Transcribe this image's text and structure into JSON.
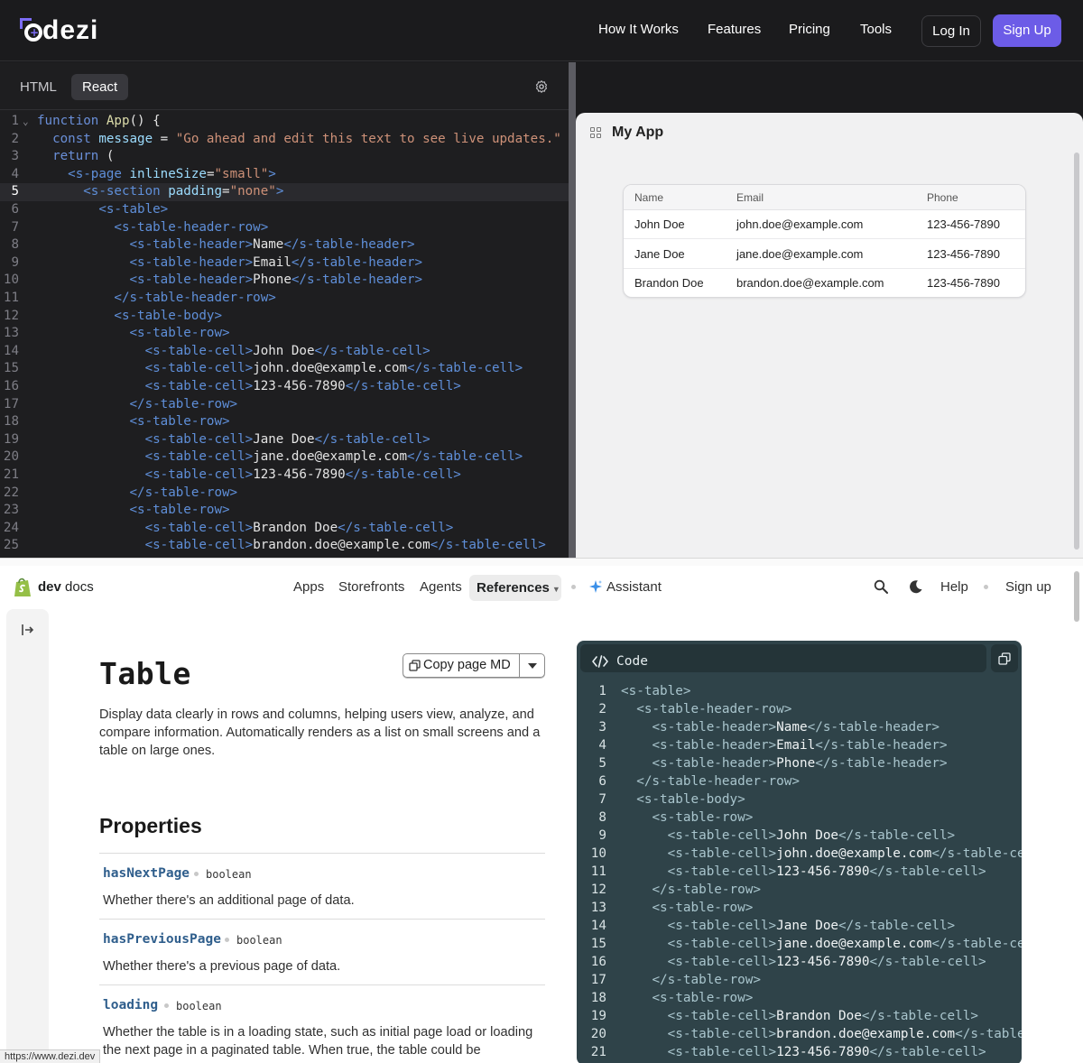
{
  "dezi": {
    "logo_text": "dezi",
    "nav": [
      "How It Works",
      "Features",
      "Pricing",
      "Tools"
    ],
    "login": "Log In",
    "signup": "Sign Up",
    "editor_tabs": [
      "HTML",
      "React"
    ],
    "active_tab": "React",
    "active_line": 5,
    "code": [
      [
        [
          "k",
          "function "
        ],
        [
          "fn",
          "App"
        ],
        [
          "tt",
          "() {"
        ]
      ],
      [
        [
          "tt",
          "  "
        ],
        [
          "k",
          "const "
        ],
        [
          "at",
          "message"
        ],
        [
          "tt",
          " = "
        ],
        [
          "str",
          "\"Go ahead and edit this text to see live updates.\""
        ]
      ],
      [
        [
          "tt",
          "  "
        ],
        [
          "k",
          "return"
        ],
        [
          "tt",
          " ("
        ]
      ],
      [
        [
          "tt",
          "    "
        ],
        [
          "tag",
          "<s-page "
        ],
        [
          "at",
          "inlineSize"
        ],
        [
          "tt",
          "="
        ],
        [
          "str",
          "\"small\""
        ],
        [
          "tag",
          ">"
        ]
      ],
      [
        [
          "tt",
          "      "
        ],
        [
          "tag",
          "<s-section "
        ],
        [
          "at",
          "padding"
        ],
        [
          "tt",
          "="
        ],
        [
          "str",
          "\"none\""
        ],
        [
          "tag",
          ">"
        ]
      ],
      [
        [
          "tt",
          "        "
        ],
        [
          "tag",
          "<s-table>"
        ]
      ],
      [
        [
          "tt",
          "          "
        ],
        [
          "tag",
          "<s-table-header-row>"
        ]
      ],
      [
        [
          "tt",
          "            "
        ],
        [
          "tag",
          "<s-table-header>"
        ],
        [
          "tt",
          "Name"
        ],
        [
          "tag",
          "</s-table-header>"
        ]
      ],
      [
        [
          "tt",
          "            "
        ],
        [
          "tag",
          "<s-table-header>"
        ],
        [
          "tt",
          "Email"
        ],
        [
          "tag",
          "</s-table-header>"
        ]
      ],
      [
        [
          "tt",
          "            "
        ],
        [
          "tag",
          "<s-table-header>"
        ],
        [
          "tt",
          "Phone"
        ],
        [
          "tag",
          "</s-table-header>"
        ]
      ],
      [
        [
          "tt",
          "          "
        ],
        [
          "tag",
          "</s-table-header-row>"
        ]
      ],
      [
        [
          "tt",
          "          "
        ],
        [
          "tag",
          "<s-table-body>"
        ]
      ],
      [
        [
          "tt",
          "            "
        ],
        [
          "tag",
          "<s-table-row>"
        ]
      ],
      [
        [
          "tt",
          "              "
        ],
        [
          "tag",
          "<s-table-cell>"
        ],
        [
          "tt",
          "John Doe"
        ],
        [
          "tag",
          "</s-table-cell>"
        ]
      ],
      [
        [
          "tt",
          "              "
        ],
        [
          "tag",
          "<s-table-cell>"
        ],
        [
          "tt",
          "john.doe@example.com"
        ],
        [
          "tag",
          "</s-table-cell>"
        ]
      ],
      [
        [
          "tt",
          "              "
        ],
        [
          "tag",
          "<s-table-cell>"
        ],
        [
          "tt",
          "123-456-7890"
        ],
        [
          "tag",
          "</s-table-cell>"
        ]
      ],
      [
        [
          "tt",
          "            "
        ],
        [
          "tag",
          "</s-table-row>"
        ]
      ],
      [
        [
          "tt",
          "            "
        ],
        [
          "tag",
          "<s-table-row>"
        ]
      ],
      [
        [
          "tt",
          "              "
        ],
        [
          "tag",
          "<s-table-cell>"
        ],
        [
          "tt",
          "Jane Doe"
        ],
        [
          "tag",
          "</s-table-cell>"
        ]
      ],
      [
        [
          "tt",
          "              "
        ],
        [
          "tag",
          "<s-table-cell>"
        ],
        [
          "tt",
          "jane.doe@example.com"
        ],
        [
          "tag",
          "</s-table-cell>"
        ]
      ],
      [
        [
          "tt",
          "              "
        ],
        [
          "tag",
          "<s-table-cell>"
        ],
        [
          "tt",
          "123-456-7890"
        ],
        [
          "tag",
          "</s-table-cell>"
        ]
      ],
      [
        [
          "tt",
          "            "
        ],
        [
          "tag",
          "</s-table-row>"
        ]
      ],
      [
        [
          "tt",
          "            "
        ],
        [
          "tag",
          "<s-table-row>"
        ]
      ],
      [
        [
          "tt",
          "              "
        ],
        [
          "tag",
          "<s-table-cell>"
        ],
        [
          "tt",
          "Brandon Doe"
        ],
        [
          "tag",
          "</s-table-cell>"
        ]
      ],
      [
        [
          "tt",
          "              "
        ],
        [
          "tag",
          "<s-table-cell>"
        ],
        [
          "tt",
          "brandon.doe@example.com"
        ],
        [
          "tag",
          "</s-table-cell>"
        ]
      ]
    ],
    "preview": {
      "app_title": "My App",
      "headers": [
        "Name",
        "Email",
        "Phone"
      ],
      "rows": [
        [
          "John Doe",
          "john.doe@example.com",
          "123-456-7890"
        ],
        [
          "Jane Doe",
          "jane.doe@example.com",
          "123-456-7890"
        ],
        [
          "Brandon Doe",
          "brandon.doe@example.com",
          "123-456-7890"
        ]
      ]
    }
  },
  "docs": {
    "brand_bold": "dev",
    "brand_rest": " docs",
    "nav": [
      "Apps",
      "Storefronts",
      "Agents"
    ],
    "nav_active": "References",
    "assistant": "Assistant",
    "help": "Help",
    "signup": "Sign up",
    "page_title": "Table",
    "copy_button": "Copy page MD",
    "intro": "Display data clearly in rows and columns, helping users view, analyze, and compare information. Automatically renders as a list on small screens and a table on large ones.",
    "properties_title": "Properties",
    "properties": [
      {
        "name": "hasNextPage",
        "type": "boolean",
        "desc": "Whether there's an additional page of data."
      },
      {
        "name": "hasPreviousPage",
        "type": "boolean",
        "desc": "Whether there's a previous page of data."
      },
      {
        "name": "loading",
        "type": "boolean",
        "desc": "Whether the table is in a loading state, such as initial page load or loading the next page in a paginated table. When true, the table could be"
      }
    ],
    "code_panel_label": "Code",
    "code": [
      [
        [
          "tg",
          "<s-table>"
        ]
      ],
      [
        [
          "tx",
          "  "
        ],
        [
          "tg",
          "<s-table-header-row>"
        ]
      ],
      [
        [
          "tx",
          "    "
        ],
        [
          "tg",
          "<s-table-header>"
        ],
        [
          "tx",
          "Name"
        ],
        [
          "tg",
          "</s-table-header>"
        ]
      ],
      [
        [
          "tx",
          "    "
        ],
        [
          "tg",
          "<s-table-header>"
        ],
        [
          "tx",
          "Email"
        ],
        [
          "tg",
          "</s-table-header>"
        ]
      ],
      [
        [
          "tx",
          "    "
        ],
        [
          "tg",
          "<s-table-header>"
        ],
        [
          "tx",
          "Phone"
        ],
        [
          "tg",
          "</s-table-header>"
        ]
      ],
      [
        [
          "tx",
          "  "
        ],
        [
          "tg",
          "</s-table-header-row>"
        ]
      ],
      [
        [
          "tx",
          "  "
        ],
        [
          "tg",
          "<s-table-body>"
        ]
      ],
      [
        [
          "tx",
          "    "
        ],
        [
          "tg",
          "<s-table-row>"
        ]
      ],
      [
        [
          "tx",
          "      "
        ],
        [
          "tg",
          "<s-table-cell>"
        ],
        [
          "tx",
          "John Doe"
        ],
        [
          "tg",
          "</s-table-cell>"
        ]
      ],
      [
        [
          "tx",
          "      "
        ],
        [
          "tg",
          "<s-table-cell>"
        ],
        [
          "tx",
          "john.doe@example.com"
        ],
        [
          "tg",
          "</s-table-ce"
        ]
      ],
      [
        [
          "tx",
          "      "
        ],
        [
          "tg",
          "<s-table-cell>"
        ],
        [
          "tx",
          "123-456-7890"
        ],
        [
          "tg",
          "</s-table-cell>"
        ]
      ],
      [
        [
          "tx",
          "    "
        ],
        [
          "tg",
          "</s-table-row>"
        ]
      ],
      [
        [
          "tx",
          "    "
        ],
        [
          "tg",
          "<s-table-row>"
        ]
      ],
      [
        [
          "tx",
          "      "
        ],
        [
          "tg",
          "<s-table-cell>"
        ],
        [
          "tx",
          "Jane Doe"
        ],
        [
          "tg",
          "</s-table-cell>"
        ]
      ],
      [
        [
          "tx",
          "      "
        ],
        [
          "tg",
          "<s-table-cell>"
        ],
        [
          "tx",
          "jane.doe@example.com"
        ],
        [
          "tg",
          "</s-table-ce"
        ]
      ],
      [
        [
          "tx",
          "      "
        ],
        [
          "tg",
          "<s-table-cell>"
        ],
        [
          "tx",
          "123-456-7890"
        ],
        [
          "tg",
          "</s-table-cell>"
        ]
      ],
      [
        [
          "tx",
          "    "
        ],
        [
          "tg",
          "</s-table-row>"
        ]
      ],
      [
        [
          "tx",
          "    "
        ],
        [
          "tg",
          "<s-table-row>"
        ]
      ],
      [
        [
          "tx",
          "      "
        ],
        [
          "tg",
          "<s-table-cell>"
        ],
        [
          "tx",
          "Brandon Doe"
        ],
        [
          "tg",
          "</s-table-cell>"
        ]
      ],
      [
        [
          "tx",
          "      "
        ],
        [
          "tg",
          "<s-table-cell>"
        ],
        [
          "tx",
          "brandon.doe@example.com"
        ],
        [
          "tg",
          "</s-table"
        ]
      ],
      [
        [
          "tx",
          "      "
        ],
        [
          "tg",
          "<s-table-cell>"
        ],
        [
          "tx",
          "123-456-7890"
        ],
        [
          "tg",
          "</s-table-cell>"
        ]
      ]
    ]
  },
  "status_url": "https://www.dezi.dev",
  "colors": {
    "accent": "#6c5ce7",
    "shopify_green": "#95bf47",
    "code_panel_bg": "#2f4349"
  },
  "icons": [
    "dezi-logo-icon",
    "gear-icon",
    "app-grid-icon",
    "shopify-bag-icon",
    "sparkle-icon",
    "search-icon",
    "moon-icon",
    "sidebar-collapse-icon",
    "copy-icon",
    "chevron-down-icon",
    "code-icon"
  ]
}
